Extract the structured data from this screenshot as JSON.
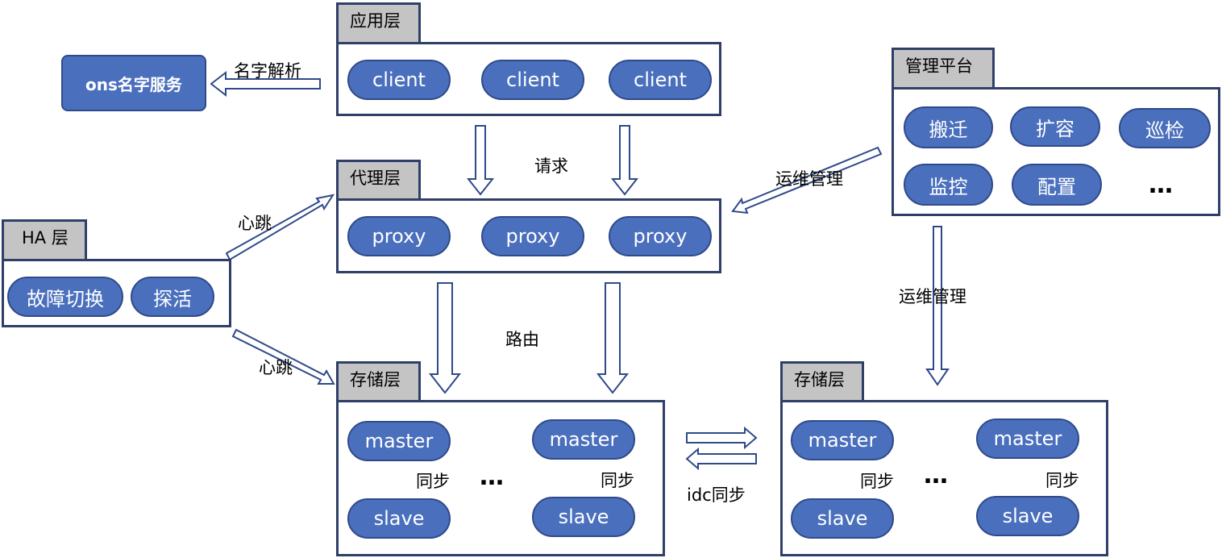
{
  "app_layer": {
    "tab": "应用层",
    "clients": [
      "client",
      "client",
      "client"
    ]
  },
  "ons": {
    "label": "ons名字服务",
    "arrow_label": "名字解析"
  },
  "request_label": "请求",
  "proxy_layer": {
    "tab": "代理层",
    "proxies": [
      "proxy",
      "proxy",
      "proxy"
    ]
  },
  "ha_layer": {
    "tab": "HA 层",
    "items": [
      "故障切换",
      "探活"
    ],
    "heartbeat_label": "心跳"
  },
  "mgmt": {
    "tab": "管理平台",
    "items": [
      "搬迁",
      "扩容",
      "巡检",
      "监控",
      "配置"
    ],
    "more": "…",
    "ops_label": "运维管理"
  },
  "route_label": "路由",
  "storage_left": {
    "tab": "存储层",
    "master": "master",
    "slave": "slave",
    "sync": "同步",
    "more": "…"
  },
  "storage_right": {
    "tab": "存储层",
    "master": "master",
    "slave": "slave",
    "sync": "同步",
    "more": "…"
  },
  "idc_sync_label": "idc同步"
}
